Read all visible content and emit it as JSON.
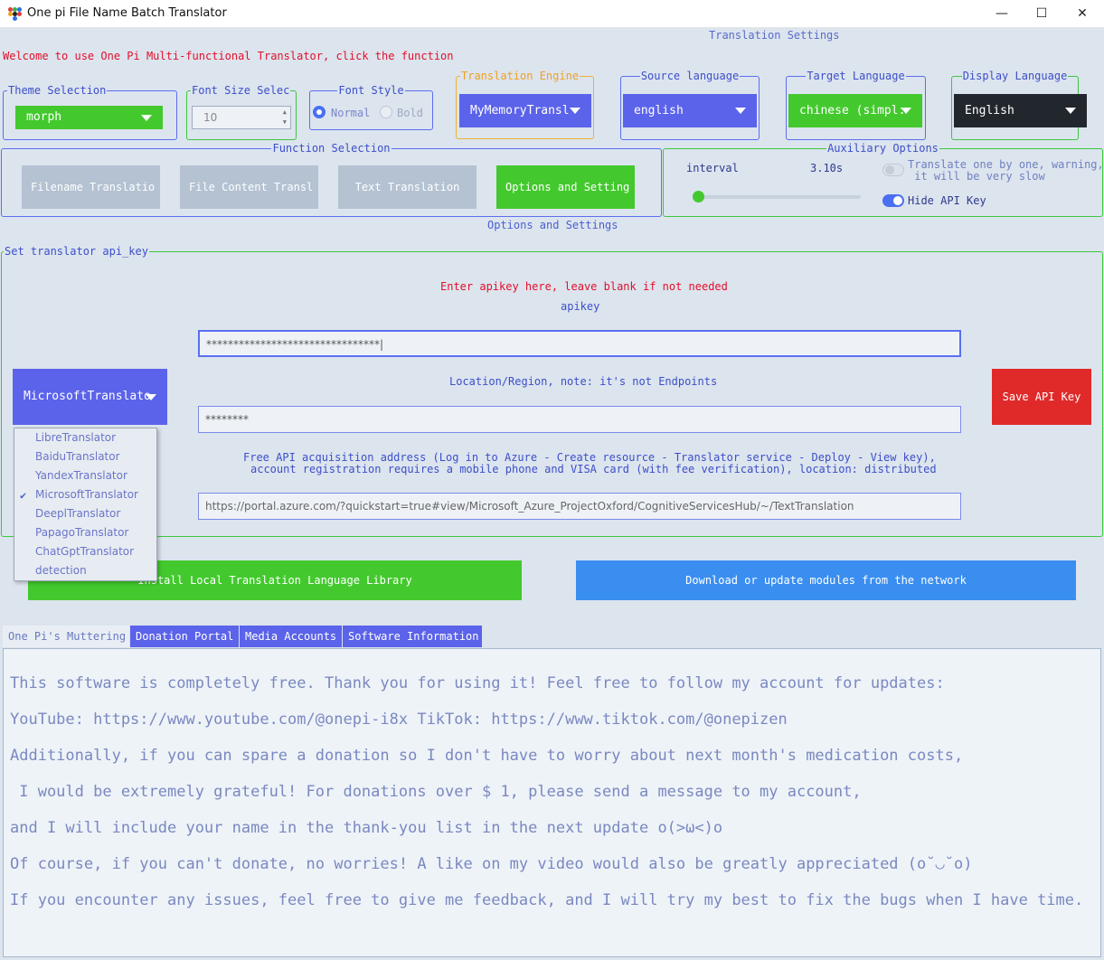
{
  "window": {
    "title": "One pi File Name Batch Translator",
    "minimize": "—",
    "maximize": "☐",
    "close": "✕"
  },
  "header": {
    "welcome": "Welcome to use One Pi Multi-functional Translator, click the function",
    "settings_title": "Translation Settings"
  },
  "theme": {
    "legend": "Theme Selection",
    "value": "morph"
  },
  "font_size": {
    "legend": "Font Size Selec",
    "value": "10"
  },
  "font_style": {
    "legend": "Font Style",
    "normal": "Normal",
    "bold": "Bold",
    "selected": "Normal"
  },
  "engine": {
    "legend": "Translation Engine",
    "value": "MyMemoryTransl"
  },
  "source_lang": {
    "legend": "Source language",
    "value": "english"
  },
  "target_lang": {
    "legend": "Target Language",
    "value": "chinese (simpl:"
  },
  "display_lang": {
    "legend": "Display Language",
    "value": "English"
  },
  "functions": {
    "legend": "Function Selection",
    "buttons": [
      "Filename Translatio",
      "File Content Transl",
      "Text Translation",
      "Options and Setting"
    ],
    "active_index": 3
  },
  "auxiliary": {
    "legend": "Auxiliary Options",
    "interval_label": "interval",
    "interval_value": "3.10s",
    "interval_slider_fraction": 0.0,
    "translate_one_by_one": "Translate one by one, warning,\n it will be very slow",
    "translate_one_by_one_on": false,
    "hide_api_key": "Hide API Key",
    "hide_api_key_on": true
  },
  "options": {
    "title": "Options and Settings",
    "api_legend": "Set translator api_key",
    "enter_note": "Enter apikey here, leave blank if not needed",
    "apikey_label": "apikey",
    "apikey_value": "********************************|",
    "location_label": "Location/Region, note: it's not Endpoints",
    "location_value": "********",
    "free_api_line1": "Free API acquisition address (Log in to Azure - Create resource - Translator service - Deploy - View key),",
    "free_api_line2": "account registration requires a mobile phone and VISA card (with fee verification), location: distributed",
    "url_value": "https://portal.azure.com/?quickstart=true#view/Microsoft_Azure_ProjectOxford/CognitiveServicesHub/~/TextTranslation",
    "translator_combo": "MicrosoftTranslato",
    "save_button": "Save API Key",
    "dropdown_items": [
      "LibreTranslator",
      "BaiduTranslator",
      "YandexTranslator",
      "MicrosoftTranslator",
      "DeeplTranslator",
      "PapagoTranslator",
      "ChatGptTranslator",
      "detection"
    ],
    "dropdown_selected_index": 3,
    "dropdown_checkmark": "✔",
    "install_button": "Install Local Translation Language Library",
    "download_button": "Download or update modules from the network"
  },
  "tabs": [
    "One Pi's Muttering",
    "Donation Portal",
    "Media Accounts",
    "Software Information"
  ],
  "tab_selected_index": 0,
  "muttering_lines": [
    "This software is completely free. Thank you for using it! Feel free to follow my account for updates:",
    "YouTube: https://www.youtube.com/@onepi-i8x TikTok: https://www.tiktok.com/@onepizen",
    "Additionally, if you can spare a donation so I don't have to worry about next month's medication costs,",
    " I would be extremely grateful! For donations over $ 1, please send a message to my account,",
    "and I will include your name in the thank-you list in the next update o(>ω<)o",
    "Of course, if you can't donate, no worries! A like on my video would also be greatly appreciated (o˘◡˘o)",
    "If you encounter any issues, feel free to give me feedback, and I will try my best to fix the bugs when I have time."
  ],
  "colors": {
    "accent_green": "#43c92d",
    "accent_blue": "#5b63ea",
    "danger_red": "#e02a2a",
    "network_blue": "#3a8ef0",
    "background": "#dce4ee"
  }
}
